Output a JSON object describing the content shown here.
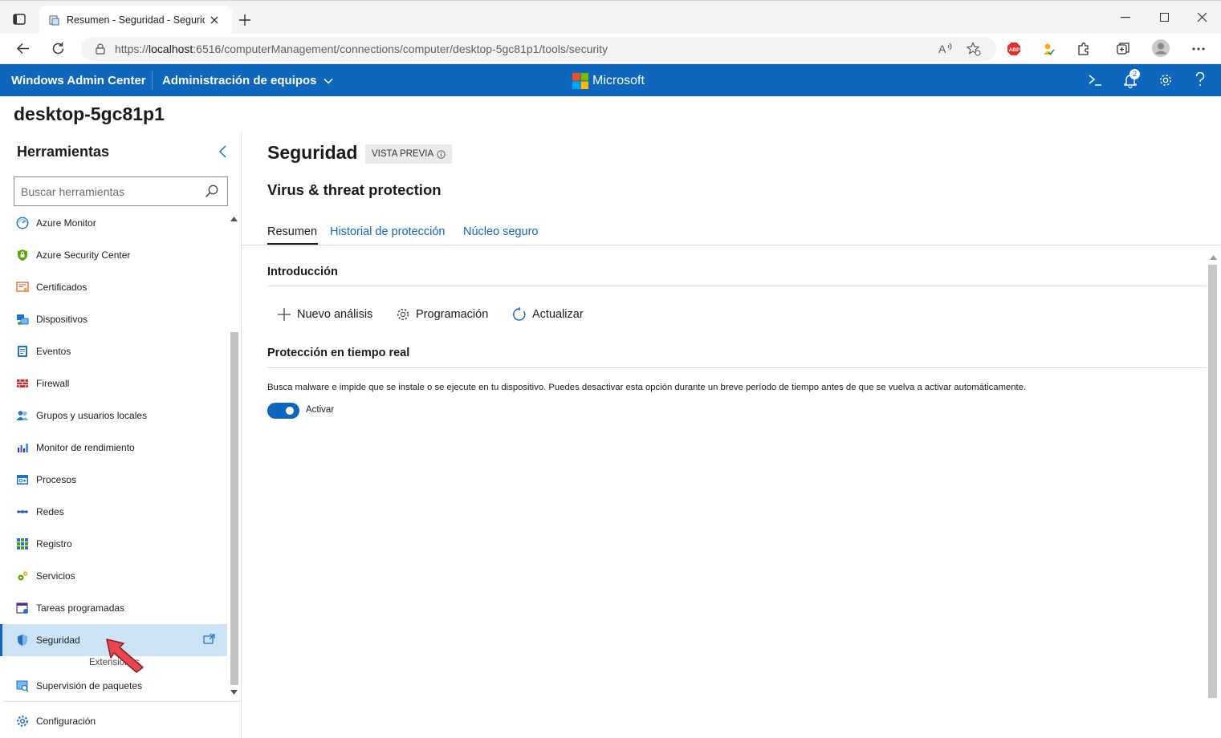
{
  "browser": {
    "tab_title": "Resumen - Seguridad - Seguridad",
    "url_prefix": "https://",
    "url_host": "localhost",
    "url_rest": ":6516/computerManagement/connections/computer/desktop-5gc81p1/tools/security"
  },
  "appbar": {
    "brand": "Windows Admin Center",
    "menu": "Administración de equipos",
    "center_logo_text": "Microsoft",
    "notification_count": "2",
    "accent_color": "#0f66bd"
  },
  "hostname": "desktop-5gc81p1",
  "sidebar": {
    "title": "Herramientas",
    "search_placeholder": "Buscar herramientas",
    "items": [
      {
        "label": "Azure Monitor",
        "icon": "azure-monitor-icon"
      },
      {
        "label": "Azure Security Center",
        "icon": "azure-security-center-icon"
      },
      {
        "label": "Certificados",
        "icon": "certificate-icon"
      },
      {
        "label": "Dispositivos",
        "icon": "devices-icon"
      },
      {
        "label": "Eventos",
        "icon": "events-icon"
      },
      {
        "label": "Firewall",
        "icon": "firewall-icon"
      },
      {
        "label": "Grupos y usuarios locales",
        "icon": "users-icon"
      },
      {
        "label": "Monitor de rendimiento",
        "icon": "performance-icon"
      },
      {
        "label": "Procesos",
        "icon": "processes-icon"
      },
      {
        "label": "Redes",
        "icon": "network-icon"
      },
      {
        "label": "Registro",
        "icon": "registry-icon"
      },
      {
        "label": "Servicios",
        "icon": "services-icon"
      },
      {
        "label": "Tareas programadas",
        "icon": "scheduled-tasks-icon"
      },
      {
        "label": "Seguridad",
        "icon": "shield-icon",
        "active": true
      }
    ],
    "extensions_label": "Extensiones",
    "extension_items": [
      {
        "label": "Supervisión de paquetes",
        "icon": "package-monitor-icon"
      }
    ],
    "settings_label": "Configuración"
  },
  "main": {
    "title": "Seguridad",
    "preview_badge": "VISTA PREVIA",
    "subtitle": "Virus & threat protection",
    "tabs": [
      "Resumen",
      "Historial de protección",
      "Núcleo seguro"
    ],
    "intro_heading": "Introducción",
    "commands": {
      "new_scan": "Nuevo análisis",
      "schedule": "Programación",
      "refresh": "Actualizar"
    },
    "realtime_heading": "Protección en tiempo real",
    "realtime_desc": "Busca malware e impide que se instale o se ejecute en tu dispositivo. Puedes desactivar esta opción durante un breve período de tiempo antes de que se vuelva a activar automáticamente.",
    "toggle_label": "Activar",
    "toggle_on": true
  }
}
